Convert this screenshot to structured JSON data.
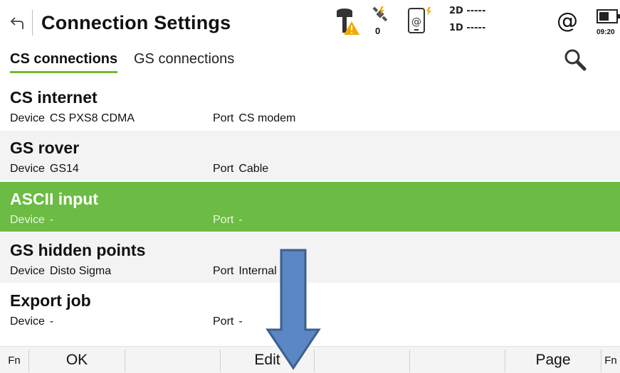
{
  "header": {
    "title": "Connection Settings",
    "satellite_count": "0",
    "dop_2d": "2D -----",
    "dop_1d": "1D -----",
    "internet_symbol": "@",
    "time": "09:20",
    "icons": {
      "back": "back-arrow-icon",
      "rover": "rover-warning-icon",
      "satellite": "satellite-icon",
      "device": "device-link-icon",
      "battery": "battery-icon"
    }
  },
  "tabs": [
    {
      "label": "CS connections",
      "active": true
    },
    {
      "label": "GS connections",
      "active": false
    }
  ],
  "search_icon": "search-icon",
  "list": {
    "device_label": "Device",
    "port_label": "Port",
    "rows": [
      {
        "title": "CS internet",
        "device": "CS PXS8 CDMA",
        "port": "CS modem",
        "selected": false
      },
      {
        "title": "GS rover",
        "device": "GS14",
        "port": "Cable",
        "selected": false
      },
      {
        "title": "ASCII input",
        "device": "-",
        "port": "-",
        "selected": true
      },
      {
        "title": "GS hidden points",
        "device": "Disto Sigma",
        "port": "Internal Disto",
        "selected": false
      },
      {
        "title": "Export job",
        "device": "-",
        "port": "-",
        "selected": false
      }
    ]
  },
  "softkeys": {
    "fn_left": "Fn",
    "ok": "OK",
    "edit": "Edit",
    "page": "Page",
    "fn_right": "Fn"
  },
  "colors": {
    "selected_row": "#6cbb45",
    "tab_underline": "#76b82a",
    "warning": "#f2a900",
    "arrow_fill": "#5b87c4",
    "arrow_stroke": "#3b5f8f"
  }
}
